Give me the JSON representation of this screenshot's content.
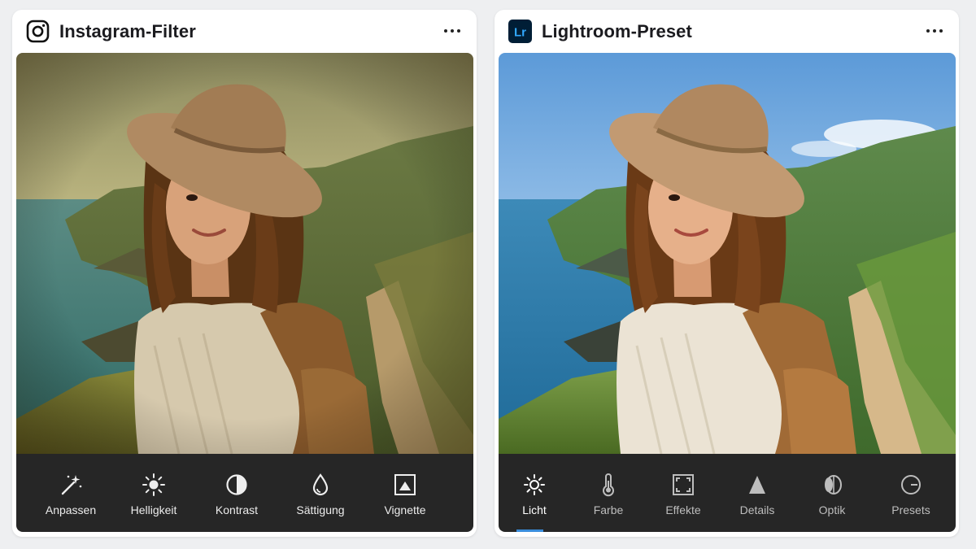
{
  "left_card": {
    "title": "Instagram-Filter",
    "app_icon": "instagram-icon",
    "more_icon": "more-dots-icon",
    "tools": [
      {
        "label": "Anpassen",
        "icon": "magic-wand-icon"
      },
      {
        "label": "Helligkeit",
        "icon": "sun-icon"
      },
      {
        "label": "Kontrast",
        "icon": "contrast-icon"
      },
      {
        "label": "Sättigung",
        "icon": "droplet-icon"
      },
      {
        "label": "Vignette",
        "icon": "vignette-icon"
      }
    ]
  },
  "right_card": {
    "title": "Lightroom-Preset",
    "app_icon": "lightroom-icon",
    "app_icon_text": "Lr",
    "more_icon": "more-dots-icon",
    "active_tool": "Licht",
    "tools": [
      {
        "label": "Licht",
        "icon": "sun-icon"
      },
      {
        "label": "Farbe",
        "icon": "thermometer-icon"
      },
      {
        "label": "Effekte",
        "icon": "frame-icon"
      },
      {
        "label": "Details",
        "icon": "triangle-icon"
      },
      {
        "label": "Optik",
        "icon": "lens-icon"
      },
      {
        "label": "Presets",
        "icon": "presets-icon"
      }
    ]
  },
  "colors": {
    "page_bg": "#eeeff1",
    "toolbar_bg": "#262626",
    "active_indicator": "#3a8ddb",
    "lightroom_blue": "#31a8ff",
    "lightroom_bg": "#001e36"
  }
}
